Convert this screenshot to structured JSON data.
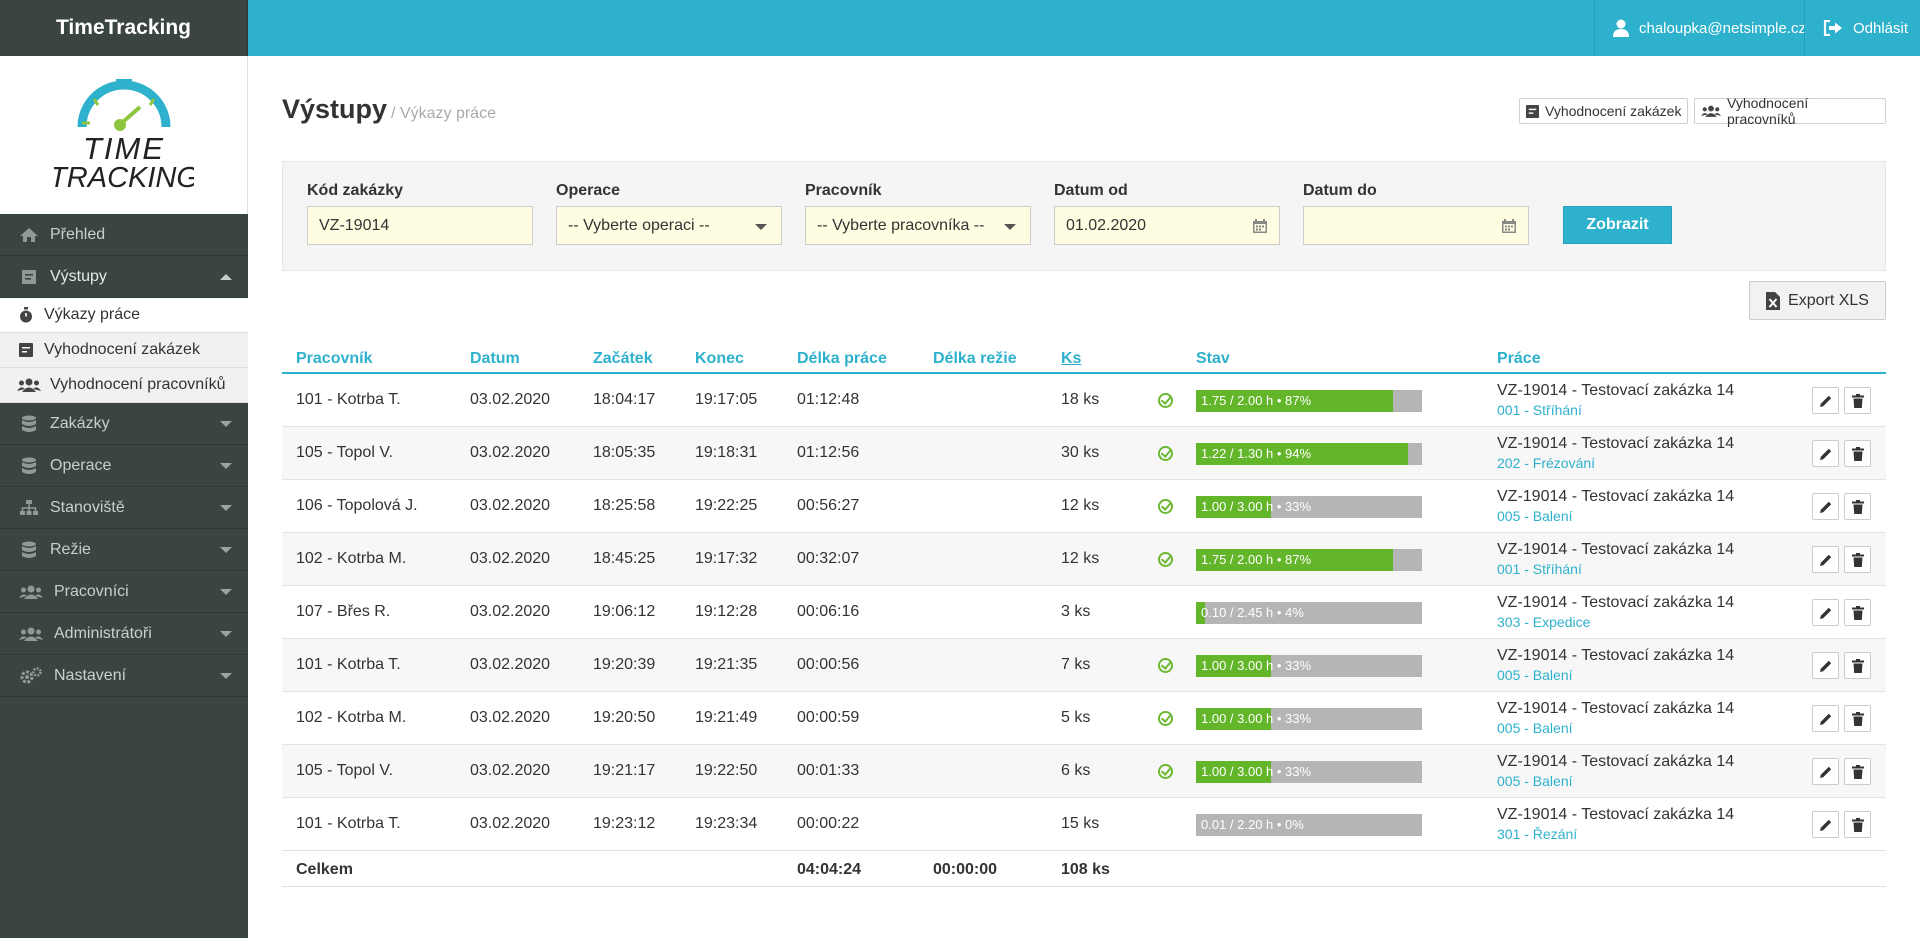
{
  "brand": "TimeTracking",
  "logo": {
    "line1": "TIME",
    "line2": "TRACKING"
  },
  "sidebar": {
    "items": [
      {
        "label": "Přehled"
      },
      {
        "label": "Výstupy"
      },
      {
        "label": "Zakázky"
      },
      {
        "label": "Operace"
      },
      {
        "label": "Stanoviště"
      },
      {
        "label": "Režie"
      },
      {
        "label": "Pracovníci"
      },
      {
        "label": "Administrátoři"
      },
      {
        "label": "Nastavení"
      }
    ],
    "subitems": [
      {
        "label": "Výkazy práce"
      },
      {
        "label": "Vyhodnocení zakázek"
      },
      {
        "label": "Vyhodnocení pracovníků"
      }
    ]
  },
  "topbar": {
    "user": "chaloupka@netsimple.cz",
    "logout": "Odhlásit"
  },
  "page": {
    "title": "Výstupy",
    "subtitle": "/ Výkazy práce",
    "btn_orders": "Vyhodnocení zakázek",
    "btn_workers": "Vyhodnocení pracovníků"
  },
  "filters": {
    "order_label": "Kód zakázky",
    "order_value": "VZ-19014",
    "operation_label": "Operace",
    "operation_value": "-- Vyberte operaci --",
    "worker_label": "Pracovník",
    "worker_value": "-- Vyberte pracovníka --",
    "date_from_label": "Datum od",
    "date_from_value": "01.02.2020",
    "date_to_label": "Datum do",
    "date_to_value": "",
    "submit": "Zobrazit"
  },
  "export_label": "Export XLS",
  "table": {
    "headers": [
      "Pracovník",
      "Datum",
      "Začátek",
      "Konec",
      "Délka práce",
      "Délka režie",
      "Ks",
      "Stav",
      "Práce"
    ],
    "rows": [
      {
        "worker": "101 - Kotrba T.",
        "date": "03.02.2020",
        "start": "18:04:17",
        "end": "19:17:05",
        "work": "01:12:48",
        "overhead": "",
        "ks": "18 ks",
        "check": true,
        "progress": 0.87,
        "state": "1.75 / 2.00 h • 87%",
        "job": "VZ-19014 - Testovací zakázka 14",
        "op": "001 - Stříhání"
      },
      {
        "worker": "105 - Topol V.",
        "date": "03.02.2020",
        "start": "18:05:35",
        "end": "19:18:31",
        "work": "01:12:56",
        "overhead": "",
        "ks": "30 ks",
        "check": true,
        "progress": 0.94,
        "state": "1.22 / 1.30 h • 94%",
        "job": "VZ-19014 - Testovací zakázka 14",
        "op": "202 - Frézování"
      },
      {
        "worker": "106 - Topolová J.",
        "date": "03.02.2020",
        "start": "18:25:58",
        "end": "19:22:25",
        "work": "00:56:27",
        "overhead": "",
        "ks": "12 ks",
        "check": true,
        "progress": 0.33,
        "state": "1.00 / 3.00 h • 33%",
        "job": "VZ-19014 - Testovací zakázka 14",
        "op": "005 - Balení"
      },
      {
        "worker": "102 - Kotrba M.",
        "date": "03.02.2020",
        "start": "18:45:25",
        "end": "19:17:32",
        "work": "00:32:07",
        "overhead": "",
        "ks": "12 ks",
        "check": true,
        "progress": 0.87,
        "state": "1.75 / 2.00 h • 87%",
        "job": "VZ-19014 - Testovací zakázka 14",
        "op": "001 - Stříhání"
      },
      {
        "worker": "107 - Břes R.",
        "date": "03.02.2020",
        "start": "19:06:12",
        "end": "19:12:28",
        "work": "00:06:16",
        "overhead": "",
        "ks": "3 ks",
        "check": false,
        "progress": 0.04,
        "state": "0.10 / 2.45 h • 4%",
        "job": "VZ-19014 - Testovací zakázka 14",
        "op": "303 - Expedice"
      },
      {
        "worker": "101 - Kotrba T.",
        "date": "03.02.2020",
        "start": "19:20:39",
        "end": "19:21:35",
        "work": "00:00:56",
        "overhead": "",
        "ks": "7 ks",
        "check": true,
        "progress": 0.33,
        "state": "1.00 / 3.00 h • 33%",
        "job": "VZ-19014 - Testovací zakázka 14",
        "op": "005 - Balení"
      },
      {
        "worker": "102 - Kotrba M.",
        "date": "03.02.2020",
        "start": "19:20:50",
        "end": "19:21:49",
        "work": "00:00:59",
        "overhead": "",
        "ks": "5 ks",
        "check": true,
        "progress": 0.33,
        "state": "1.00 / 3.00 h • 33%",
        "job": "VZ-19014 - Testovací zakázka 14",
        "op": "005 - Balení"
      },
      {
        "worker": "105 - Topol V.",
        "date": "03.02.2020",
        "start": "19:21:17",
        "end": "19:22:50",
        "work": "00:01:33",
        "overhead": "",
        "ks": "6 ks",
        "check": true,
        "progress": 0.33,
        "state": "1.00 / 3.00 h • 33%",
        "job": "VZ-19014 - Testovací zakázka 14",
        "op": "005 - Balení"
      },
      {
        "worker": "101 - Kotrba T.",
        "date": "03.02.2020",
        "start": "19:23:12",
        "end": "19:23:34",
        "work": "00:00:22",
        "overhead": "",
        "ks": "15 ks",
        "check": false,
        "progress": 0.0,
        "state": "0.01 / 2.20 h • 0%",
        "job": "VZ-19014 - Testovací zakázka 14",
        "op": "301 - Řezání"
      }
    ],
    "total": {
      "label": "Celkem",
      "work": "04:04:24",
      "overhead": "00:00:00",
      "ks": "108 ks"
    }
  },
  "colors": {
    "accent": "#2eb1cc",
    "sidebar": "#3a4440",
    "progress": "#63b52a",
    "input_bg": "#fffde1"
  }
}
